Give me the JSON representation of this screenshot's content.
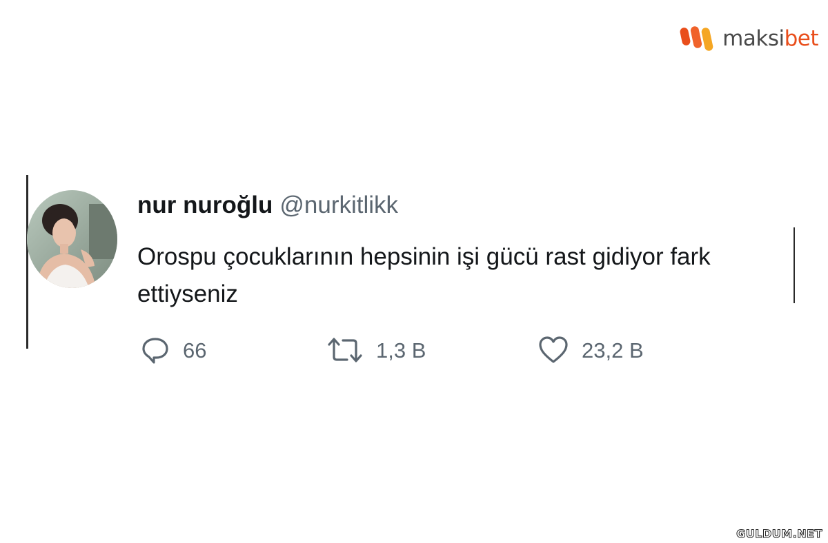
{
  "brand": {
    "name_main": "maksi",
    "name_accent": "bet",
    "logo_icon": "maksibet-logo-icon",
    "colors": {
      "accent": "#e94e1b",
      "secondary": "#f5a623",
      "text": "#4a4a4a"
    }
  },
  "tweet": {
    "display_name": "nur nuroğlu",
    "handle": "@nurkitlikk",
    "text": "Orospu çocuklarının hepsinin işi gücü rast gidiyor fark ettiyseniz",
    "avatar_icon": "profile-photo",
    "actions": {
      "reply": {
        "icon": "reply-icon",
        "count": "66"
      },
      "retweet": {
        "icon": "retweet-icon",
        "count": "1,3 B"
      },
      "like": {
        "icon": "heart-icon",
        "count": "23,2 B"
      }
    }
  },
  "watermark": "GULDUM.NET"
}
